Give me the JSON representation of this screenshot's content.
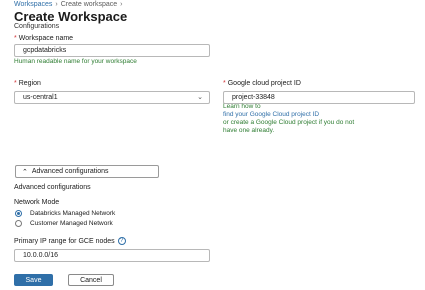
{
  "breadcrumb": {
    "items": [
      "Workspaces",
      "Create workspace"
    ],
    "separator": "›"
  },
  "page": {
    "title": "Create Workspace",
    "subtitle": "Configurations"
  },
  "workspace_name": {
    "label": "Workspace name",
    "value": "gcpdatabricks",
    "hint": "Human readable name for your workspace"
  },
  "region": {
    "label": "Region",
    "value": "us-central1"
  },
  "project": {
    "label": "Google cloud project ID",
    "value": "project-33848",
    "learn_how": "Learn how to",
    "find_link": "find your Google Cloud project ID",
    "create_line1": "or create a Google Cloud project if you do not",
    "create_line2": "have one already."
  },
  "advanced": {
    "toggle_label": "Advanced configurations",
    "section_title": "Advanced configurations",
    "network_mode_label": "Network Mode",
    "options": [
      "Databricks Managed Network",
      "Customer Managed Network"
    ],
    "selected_index": 0
  },
  "ip_range": {
    "label": "Primary IP range for GCE nodes",
    "value": "10.0.0.0/16"
  },
  "actions": {
    "save_label": "Save",
    "cancel_label": "Cancel"
  },
  "colors": {
    "link": "#2f6fa8",
    "primary": "#2f6fa8",
    "hint_green": "#2e7d32",
    "required": "#d13438"
  }
}
